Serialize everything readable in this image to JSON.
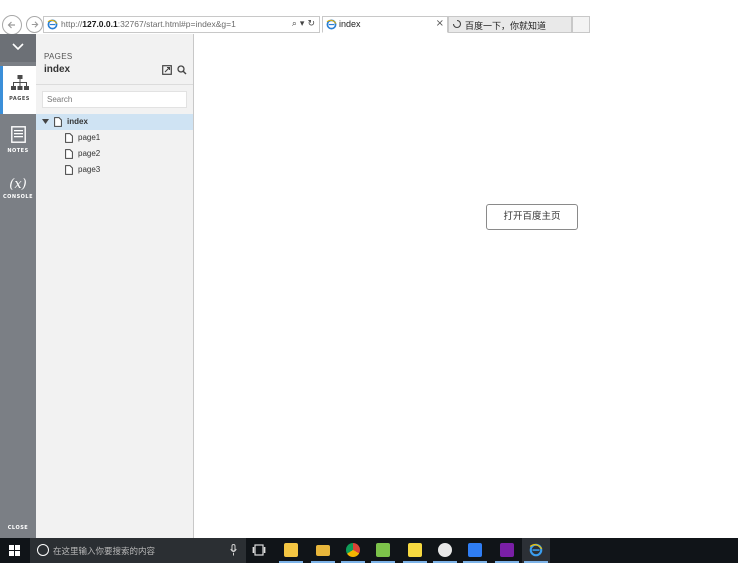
{
  "browser": {
    "address": {
      "prefix": "http://",
      "host": "127.0.0.1",
      "rest": ":32767/start.html#p=index&g=1"
    },
    "address_tools": {
      "search": "⌕",
      "dropdown": "▾",
      "refresh": "↻"
    },
    "tabs": [
      {
        "label": "index",
        "close": "×"
      },
      {
        "label": "百度一下，你就知道"
      }
    ]
  },
  "rail": {
    "pages_label": "PAGES",
    "notes_label": "NOTES",
    "console_symbol": "(x)",
    "console_label": "CONSOLE",
    "close_label": "CLOSE"
  },
  "pages_panel": {
    "heading": "PAGES",
    "current_page": "index",
    "search_placeholder": "Search",
    "tree": {
      "root": "index",
      "children": [
        "page1",
        "page2",
        "page3"
      ]
    }
  },
  "canvas": {
    "button_label": "打开百度主页"
  },
  "taskbar": {
    "search_placeholder": "在这里输入你要搜索的内容",
    "apps": [
      "file-viewer",
      "file-explorer",
      "chrome",
      "notepad",
      "sticky-notes",
      "github",
      "feishu",
      "axure-rp",
      "internet-explorer"
    ]
  },
  "colors": {
    "rail": "#7b7f85",
    "rail_active_accent": "#3b8fd9",
    "tree_selected": "#cfe3f3",
    "panel_bg": "#f2f2f2",
    "taskbar": "#101418"
  }
}
